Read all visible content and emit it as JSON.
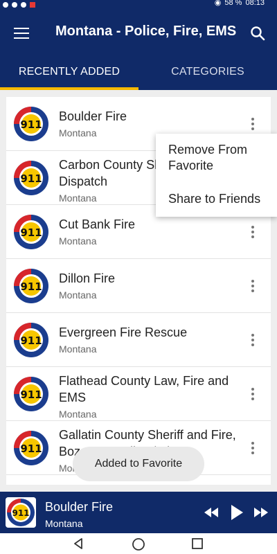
{
  "status_bar": {
    "battery": "58 %",
    "time": "08:13"
  },
  "app_bar": {
    "title": "Montana - Police, Fire, EMS",
    "menu_icon": "hamburger-menu-icon",
    "search_icon": "search-icon"
  },
  "tabs": [
    {
      "label": "RECENTLY ADDED",
      "active": true
    },
    {
      "label": "CATEGORIES",
      "active": false
    }
  ],
  "colors": {
    "primary": "#102a68",
    "accent": "#f5b800",
    "logo_red": "#d7262b",
    "logo_blue": "#1b3d8e",
    "logo_yellow": "#f7c600"
  },
  "logo": {
    "center": "911",
    "ring_left": "FIRE·EMS",
    "ring_right": "POLICE",
    "ring_bottom": "DISPATCH"
  },
  "stations": [
    {
      "title": "Boulder Fire",
      "location": "Montana"
    },
    {
      "title": "Carbon County Sheriff and Fire Dispatch",
      "location": "Montana"
    },
    {
      "title": "Cut Bank Fire",
      "location": "Montana"
    },
    {
      "title": "Dillon Fire",
      "location": "Montana"
    },
    {
      "title": "Evergreen Fire Rescue",
      "location": "Montana"
    },
    {
      "title": "Flathead County Law, Fire and EMS",
      "location": "Montana"
    },
    {
      "title": "Gallatin County Sheriff and Fire, Bozeman Police / Fire",
      "location": "Montana"
    }
  ],
  "context_menu": {
    "remove_label": "Remove From Favorite",
    "share_label": "Share to Friends"
  },
  "toast": {
    "message": "Added to Favorite"
  },
  "player": {
    "title": "Boulder Fire",
    "subtitle": "Montana"
  }
}
